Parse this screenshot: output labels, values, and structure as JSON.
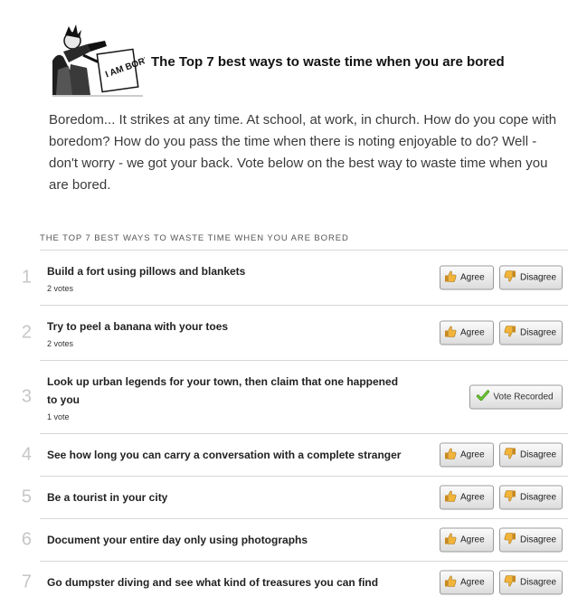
{
  "header": {
    "title": "The Top 7 best ways to waste time when you are bored",
    "hero_sign_text": "I AM BORED"
  },
  "intro": "Boredom... It strikes at any time. At school, at work, in church. How do you cope with boredom? How do you pass the time when there is noting enjoyable to do? Well - don't worry - we got your back. Vote below on the best way to waste time when you are bored.",
  "list": {
    "heading": "THE TOP 7 BEST WAYS TO WASTE TIME WHEN YOU ARE BORED",
    "agree_label": "Agree",
    "disagree_label": "Disagree",
    "recorded_label": "Vote Recorded",
    "items": [
      {
        "rank": "1",
        "title": "Build a fort using pillows and blankets",
        "votes": "2 votes",
        "state": "open"
      },
      {
        "rank": "2",
        "title": "Try to peel a banana with your toes",
        "votes": "2 votes",
        "state": "open"
      },
      {
        "rank": "3",
        "title": "Look up urban legends for your town, then claim that one happened to you",
        "votes": "1 vote",
        "state": "recorded"
      },
      {
        "rank": "4",
        "title": "See how long you can carry a conversation with a complete stranger",
        "votes": "",
        "state": "open"
      },
      {
        "rank": "5",
        "title": "Be a tourist in your city",
        "votes": "",
        "state": "open"
      },
      {
        "rank": "6",
        "title": "Document your entire day only using photographs",
        "votes": "",
        "state": "open"
      },
      {
        "rank": "7",
        "title": "Go dumpster diving and see what kind of treasures you can find",
        "votes": "",
        "state": "open"
      }
    ]
  },
  "colors": {
    "thumb_fill": "#f2b53a",
    "check_fill": "#6cc832"
  }
}
